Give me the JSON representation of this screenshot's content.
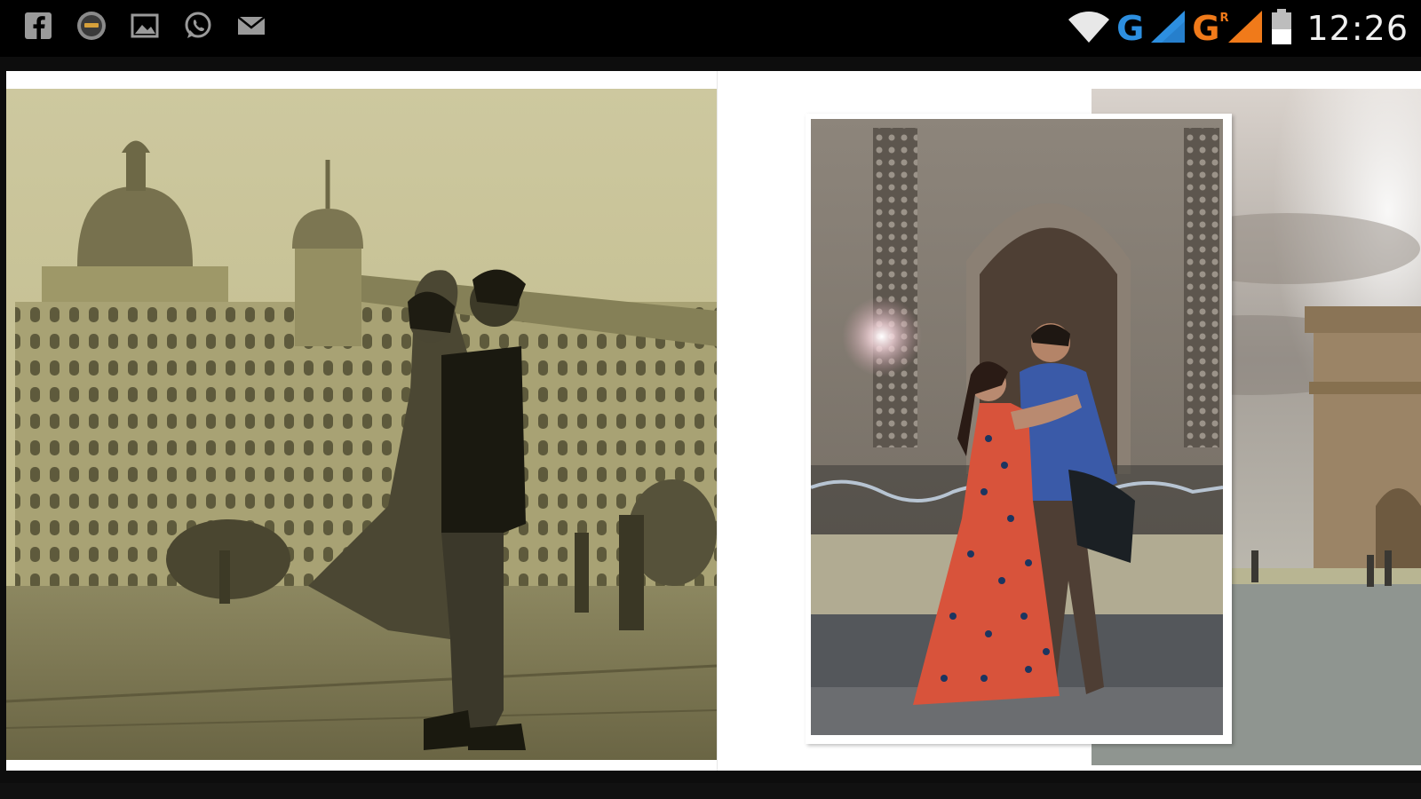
{
  "status_bar": {
    "left_icons": [
      "facebook-icon",
      "app-badge-icon",
      "gallery-icon",
      "whatsapp-icon",
      "mail-icon"
    ],
    "right_icons": [
      "wifi-icon",
      "signal-icon",
      "signal-icon",
      "battery-icon"
    ],
    "network_1": "G",
    "network_2": "G",
    "roaming_mark": "R",
    "time": "12:26",
    "colors": {
      "network_1": "#2d8fe0",
      "network_2": "#f07a1a"
    }
  },
  "album": {
    "left_page": {
      "photo": "sepia-couple-photo",
      "tone": "#c3bd8e"
    },
    "right_page": {
      "front_photo": "couple-at-gateway-arch-photo",
      "back_photo": "gateway-monument-photo"
    }
  }
}
